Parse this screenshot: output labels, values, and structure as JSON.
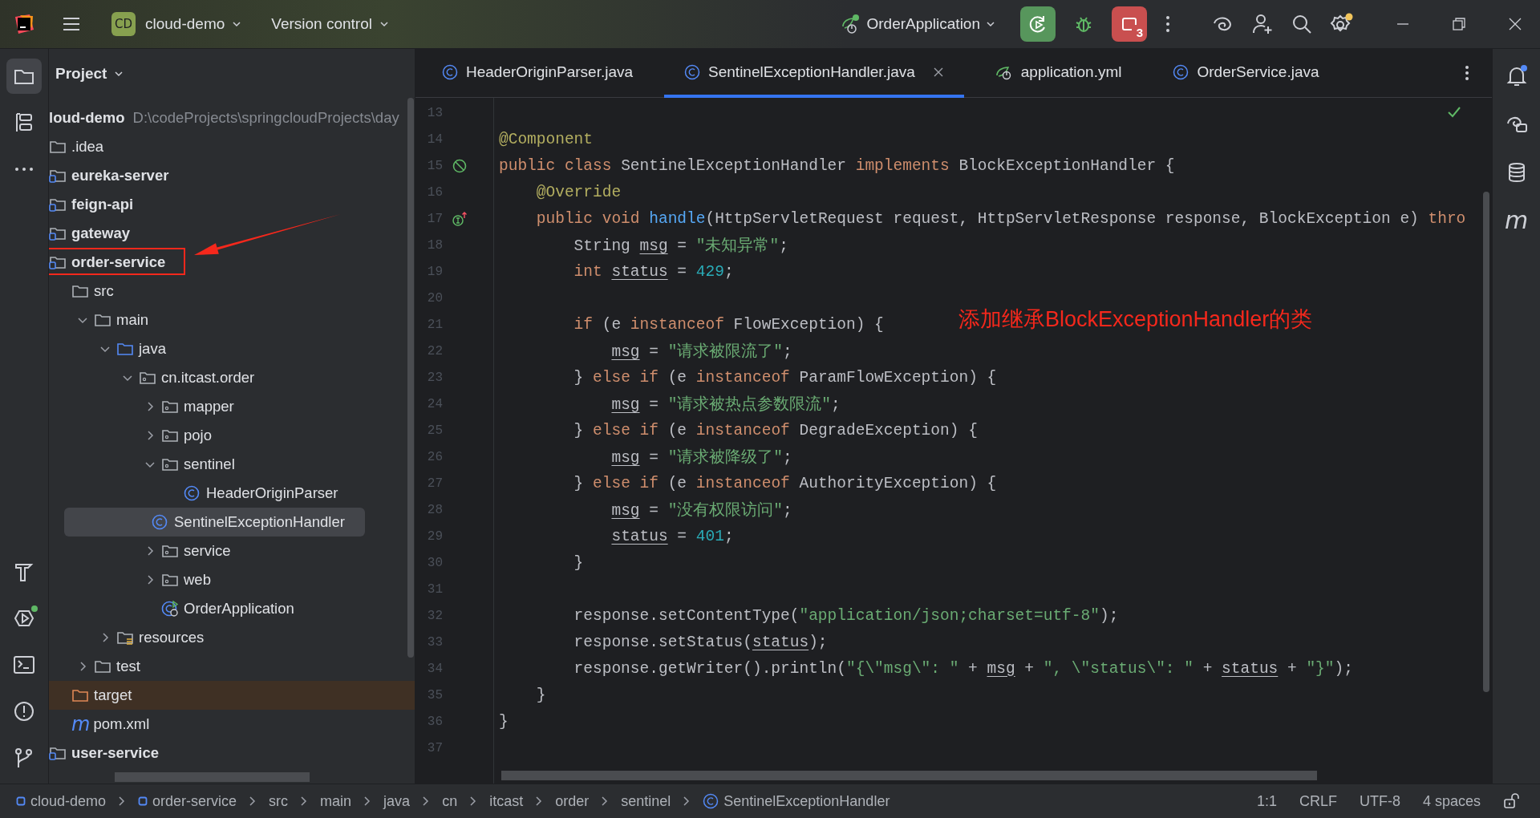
{
  "toolbar": {
    "project": {
      "badge": "CD",
      "name": "cloud-demo"
    },
    "vcs": "Version control",
    "run_config": "OrderApplication",
    "running_count": "3",
    "settings_update": true
  },
  "tool_windows_top": [
    {
      "kind": "project",
      "selected": true,
      "notified": false
    },
    {
      "kind": "structure",
      "selected": false,
      "notified": false
    },
    {
      "kind": "more",
      "selected": false,
      "notified": false
    }
  ],
  "tool_windows_bottom": [
    {
      "kind": "build",
      "selected": false,
      "notified": false
    },
    {
      "kind": "services",
      "selected": false,
      "notified": true
    },
    {
      "kind": "terminal",
      "selected": false,
      "notified": false
    },
    {
      "kind": "problems",
      "selected": false,
      "notified": false
    },
    {
      "kind": "git",
      "selected": false,
      "notified": false
    }
  ],
  "project_panel": {
    "title": "Project",
    "tree": [
      {
        "label": "loud-demo",
        "path": "D:\\codeProjects\\springcloudProjects\\day",
        "kind": "root",
        "selected": false,
        "children": [
          {
            "label": ".idea",
            "kind": "folder",
            "selected": false
          },
          {
            "label": "eureka-server",
            "kind": "module",
            "selected": false
          },
          {
            "label": "feign-api",
            "kind": "module",
            "selected": false
          },
          {
            "label": "gateway",
            "kind": "module",
            "selected": false
          },
          {
            "label": "order-service",
            "kind": "module",
            "selected": false,
            "marked": true,
            "children": [
              {
                "label": "src",
                "kind": "folder",
                "selected": false,
                "children": [
                  {
                    "label": "main",
                    "kind": "folder",
                    "expanded": true,
                    "selected": false,
                    "children": [
                      {
                        "label": "java",
                        "kind": "source-folder",
                        "expanded": true,
                        "selected": false,
                        "children": [
                          {
                            "label": "cn.itcast.order",
                            "kind": "package",
                            "expanded": true,
                            "selected": false,
                            "children": [
                              {
                                "label": "mapper",
                                "kind": "package",
                                "expanded": false,
                                "selected": false
                              },
                              {
                                "label": "pojo",
                                "kind": "package",
                                "expanded": false,
                                "selected": false
                              },
                              {
                                "label": "sentinel",
                                "kind": "package",
                                "expanded": true,
                                "selected": false,
                                "children": [
                                  {
                                    "label": "HeaderOriginParser",
                                    "kind": "class",
                                    "selected": false
                                  },
                                  {
                                    "label": "SentinelExceptionHandler",
                                    "kind": "class",
                                    "selected": true
                                  }
                                ]
                              },
                              {
                                "label": "service",
                                "kind": "package",
                                "expanded": false,
                                "selected": false
                              },
                              {
                                "label": "web",
                                "kind": "package",
                                "expanded": false,
                                "selected": false
                              },
                              {
                                "label": "OrderApplication",
                                "kind": "spring-class",
                                "selected": false
                              }
                            ]
                          }
                        ]
                      },
                      {
                        "label": "resources",
                        "kind": "resource-folder",
                        "expanded": false,
                        "selected": false
                      }
                    ]
                  },
                  {
                    "label": "test",
                    "kind": "folder",
                    "expanded": false,
                    "selected": false
                  }
                ]
              },
              {
                "label": "target",
                "kind": "excluded-folder",
                "selected": false
              },
              {
                "label": "pom.xml",
                "kind": "maven",
                "glyph": "m",
                "selected": false
              }
            ]
          },
          {
            "label": "user-service",
            "kind": "module",
            "selected": false
          }
        ]
      }
    ]
  },
  "tabs": [
    {
      "label": "HeaderOriginParser.java",
      "kind": "class",
      "selected": false
    },
    {
      "label": "SentinelExceptionHandler.java",
      "kind": "class",
      "selected": true
    },
    {
      "label": "application.yml",
      "kind": "spring",
      "selected": false
    },
    {
      "label": "OrderService.java",
      "kind": "class",
      "selected": false
    }
  ],
  "editor": {
    "note": "添加继承BlockExceptionHandler的类",
    "lines": [
      {
        "number": "13"
      },
      {
        "number": "14",
        "segments": [
          {
            "text": "@Component",
            "kind": "annotation"
          }
        ]
      },
      {
        "number": "15",
        "kind": "bean",
        "segments": [
          {
            "text": "public class",
            "kind": "keyword"
          },
          {
            "text": " SentinelExceptionHandler ",
            "kind": "plain"
          },
          {
            "text": "implements",
            "kind": "keyword"
          },
          {
            "text": " BlockExceptionHandler {",
            "kind": "plain"
          }
        ]
      },
      {
        "number": "16",
        "segments": [
          {
            "text": "    @Override",
            "kind": "annotation"
          }
        ]
      },
      {
        "number": "17",
        "kind": "implements",
        "segments": [
          {
            "text": "    public void ",
            "kind": "keyword"
          },
          {
            "text": "handle",
            "kind": "method"
          },
          {
            "text": "(HttpServletRequest request, HttpServletResponse response, BlockException e) ",
            "kind": "plain"
          },
          {
            "text": "thro",
            "kind": "keyword"
          }
        ]
      },
      {
        "number": "18",
        "segments": [
          {
            "text": "        String ",
            "kind": "plain"
          },
          {
            "text": "msg",
            "kind": "var"
          },
          {
            "text": " = ",
            "kind": "plain"
          },
          {
            "text": "\"未知异常\"",
            "kind": "string"
          },
          {
            "text": ";",
            "kind": "plain"
          }
        ]
      },
      {
        "number": "19",
        "segments": [
          {
            "text": "        int ",
            "kind": "keyword"
          },
          {
            "text": "status",
            "kind": "var"
          },
          {
            "text": " = ",
            "kind": "plain"
          },
          {
            "text": "429",
            "kind": "number"
          },
          {
            "text": ";",
            "kind": "plain"
          }
        ]
      },
      {
        "number": "20"
      },
      {
        "number": "21",
        "segments": [
          {
            "text": "        if",
            "kind": "keyword"
          },
          {
            "text": " (e ",
            "kind": "plain"
          },
          {
            "text": "instanceof",
            "kind": "keyword"
          },
          {
            "text": " FlowException) {",
            "kind": "plain"
          }
        ]
      },
      {
        "number": "22",
        "segments": [
          {
            "text": "            msg",
            "kind": "var"
          },
          {
            "text": " = ",
            "kind": "plain"
          },
          {
            "text": "\"请求被限流了\"",
            "kind": "string"
          },
          {
            "text": ";",
            "kind": "plain"
          }
        ]
      },
      {
        "number": "23",
        "segments": [
          {
            "text": "        } ",
            "kind": "plain"
          },
          {
            "text": "else if",
            "kind": "keyword"
          },
          {
            "text": " (e ",
            "kind": "plain"
          },
          {
            "text": "instanceof",
            "kind": "keyword"
          },
          {
            "text": " ParamFlowException) {",
            "kind": "plain"
          }
        ]
      },
      {
        "number": "24",
        "segments": [
          {
            "text": "            msg",
            "kind": "var"
          },
          {
            "text": " = ",
            "kind": "plain"
          },
          {
            "text": "\"请求被热点参数限流\"",
            "kind": "string"
          },
          {
            "text": ";",
            "kind": "plain"
          }
        ]
      },
      {
        "number": "25",
        "segments": [
          {
            "text": "        } ",
            "kind": "plain"
          },
          {
            "text": "else if",
            "kind": "keyword"
          },
          {
            "text": " (e ",
            "kind": "plain"
          },
          {
            "text": "instanceof",
            "kind": "keyword"
          },
          {
            "text": " DegradeException) {",
            "kind": "plain"
          }
        ]
      },
      {
        "number": "26",
        "segments": [
          {
            "text": "            msg",
            "kind": "var"
          },
          {
            "text": " = ",
            "kind": "plain"
          },
          {
            "text": "\"请求被降级了\"",
            "kind": "string"
          },
          {
            "text": ";",
            "kind": "plain"
          }
        ]
      },
      {
        "number": "27",
        "segments": [
          {
            "text": "        } ",
            "kind": "plain"
          },
          {
            "text": "else if",
            "kind": "keyword"
          },
          {
            "text": " (e ",
            "kind": "plain"
          },
          {
            "text": "instanceof",
            "kind": "keyword"
          },
          {
            "text": " AuthorityException) {",
            "kind": "plain"
          }
        ]
      },
      {
        "number": "28",
        "segments": [
          {
            "text": "            msg",
            "kind": "var"
          },
          {
            "text": " = ",
            "kind": "plain"
          },
          {
            "text": "\"没有权限访问\"",
            "kind": "string"
          },
          {
            "text": ";",
            "kind": "plain"
          }
        ]
      },
      {
        "number": "29",
        "segments": [
          {
            "text": "            status",
            "kind": "var"
          },
          {
            "text": " = ",
            "kind": "plain"
          },
          {
            "text": "401",
            "kind": "number"
          },
          {
            "text": ";",
            "kind": "plain"
          }
        ]
      },
      {
        "number": "30",
        "segments": [
          {
            "text": "        }",
            "kind": "plain"
          }
        ]
      },
      {
        "number": "31"
      },
      {
        "number": "32",
        "segments": [
          {
            "text": "        response.setContentType(",
            "kind": "plain"
          },
          {
            "text": "\"application/json;charset=utf-8\"",
            "kind": "string"
          },
          {
            "text": ");",
            "kind": "plain"
          }
        ]
      },
      {
        "number": "33",
        "segments": [
          {
            "text": "        response.setStatus(",
            "kind": "plain"
          },
          {
            "text": "status",
            "kind": "var"
          },
          {
            "text": ");",
            "kind": "plain"
          }
        ]
      },
      {
        "number": "34",
        "segments": [
          {
            "text": "        response.getWriter().println(",
            "kind": "plain"
          },
          {
            "text": "\"{\\\"msg\\\": \"",
            "kind": "string"
          },
          {
            "text": " + ",
            "kind": "plain"
          },
          {
            "text": "msg",
            "kind": "var"
          },
          {
            "text": " + ",
            "kind": "plain"
          },
          {
            "text": "\", \\\"status\\\": \"",
            "kind": "string"
          },
          {
            "text": " + ",
            "kind": "plain"
          },
          {
            "text": "status",
            "kind": "var"
          },
          {
            "text": " + ",
            "kind": "plain"
          },
          {
            "text": "\"}\"",
            "kind": "string"
          },
          {
            "text": ");",
            "kind": "plain"
          }
        ]
      },
      {
        "number": "35",
        "segments": [
          {
            "text": "    }",
            "kind": "plain"
          }
        ]
      },
      {
        "number": "36",
        "segments": [
          {
            "text": "}",
            "kind": "plain"
          }
        ]
      },
      {
        "number": "37"
      }
    ]
  },
  "right_tools": [
    {
      "kind": "notifications",
      "notified": true
    },
    {
      "kind": "ai-chat",
      "notified": false
    },
    {
      "kind": "database",
      "notified": false
    },
    {
      "kind": "maven",
      "glyph": "m",
      "notified": false
    }
  ],
  "breadcrumbs": [
    {
      "label": "cloud-demo",
      "kind": "module"
    },
    {
      "label": "order-service",
      "kind": "module"
    },
    {
      "label": "src",
      "kind": "plain"
    },
    {
      "label": "main",
      "kind": "plain"
    },
    {
      "label": "java",
      "kind": "plain"
    },
    {
      "label": "cn",
      "kind": "plain"
    },
    {
      "label": "itcast",
      "kind": "plain"
    },
    {
      "label": "order",
      "kind": "plain"
    },
    {
      "label": "sentinel",
      "kind": "plain"
    },
    {
      "label": "SentinelExceptionHandler",
      "kind": "class"
    }
  ],
  "status_bar": [
    "1:1",
    "CRLF",
    "UTF-8",
    "4 spaces"
  ]
}
